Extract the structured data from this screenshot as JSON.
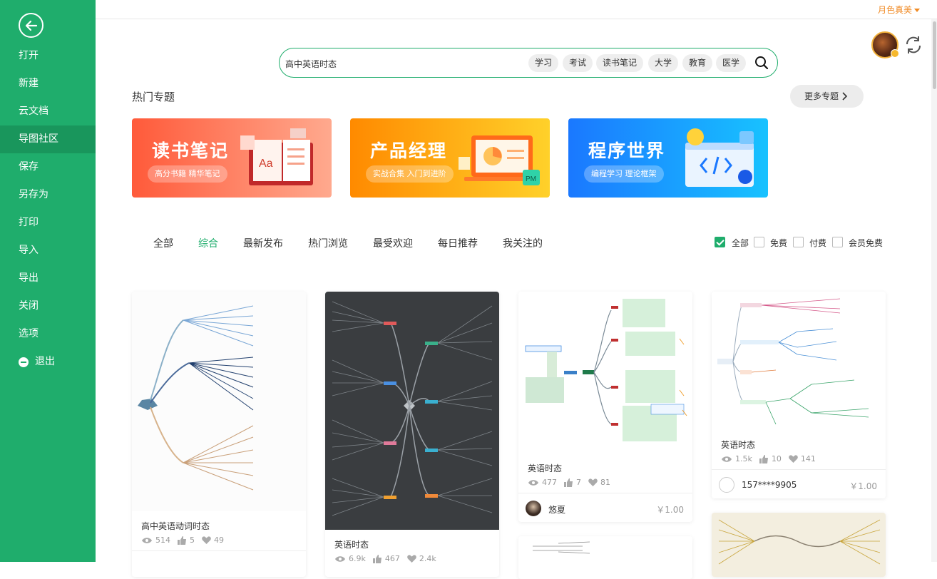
{
  "sidebar": {
    "items": [
      {
        "label": "打开"
      },
      {
        "label": "新建"
      },
      {
        "label": "云文档"
      },
      {
        "label": "导图社区"
      },
      {
        "label": "保存"
      },
      {
        "label": "另存为"
      },
      {
        "label": "打印"
      },
      {
        "label": "导入"
      },
      {
        "label": "导出"
      },
      {
        "label": "关闭"
      },
      {
        "label": "选项"
      },
      {
        "label": "退出"
      }
    ],
    "active_index": 3
  },
  "header": {
    "username": "月色真美"
  },
  "search": {
    "value": "高中英语时态",
    "tags": [
      "学习",
      "考试",
      "读书笔记",
      "大学",
      "教育",
      "医学"
    ]
  },
  "section": {
    "title": "热门专题",
    "more_label": "更多专题"
  },
  "banners": [
    {
      "title": "读书笔记",
      "subtitle": "高分书籍 精华笔记",
      "color_from": "#ff5a3a",
      "color_to": "#ffa98e"
    },
    {
      "title": "产品经理",
      "subtitle": "实战合集 入门到进阶",
      "color_from": "#ff8a00",
      "color_to": "#ffd12a"
    },
    {
      "title": "程序世界",
      "subtitle": "编程学习 理论框架",
      "color_from": "#1a78ff",
      "color_to": "#18c2ff"
    }
  ],
  "tabs": [
    "全部",
    "综合",
    "最新发布",
    "热门浏览",
    "最受欢迎",
    "每日推荐",
    "我关注的"
  ],
  "active_tab": 1,
  "filters": [
    {
      "label": "全部",
      "checked": true
    },
    {
      "label": "免费",
      "checked": false
    },
    {
      "label": "付费",
      "checked": false
    },
    {
      "label": "会员免费",
      "checked": false
    }
  ],
  "cards": [
    {
      "title": "高中英语动词时态",
      "views": "514",
      "likes": "5",
      "favorites": "49"
    },
    {
      "title": "英语时态",
      "views": "6.9k",
      "likes": "467",
      "favorites": "2.4k"
    },
    {
      "title": "英语时态",
      "views": "477",
      "likes": "7",
      "favorites": "81",
      "author": "悠夏",
      "price": "￥1.00"
    },
    {
      "title": "英语时态",
      "views": "1.5k",
      "likes": "10",
      "favorites": "141",
      "author": "157****9905",
      "price": "￥1.00"
    }
  ],
  "colors": {
    "accent": "#1fad6c",
    "user": "#f08a24"
  }
}
